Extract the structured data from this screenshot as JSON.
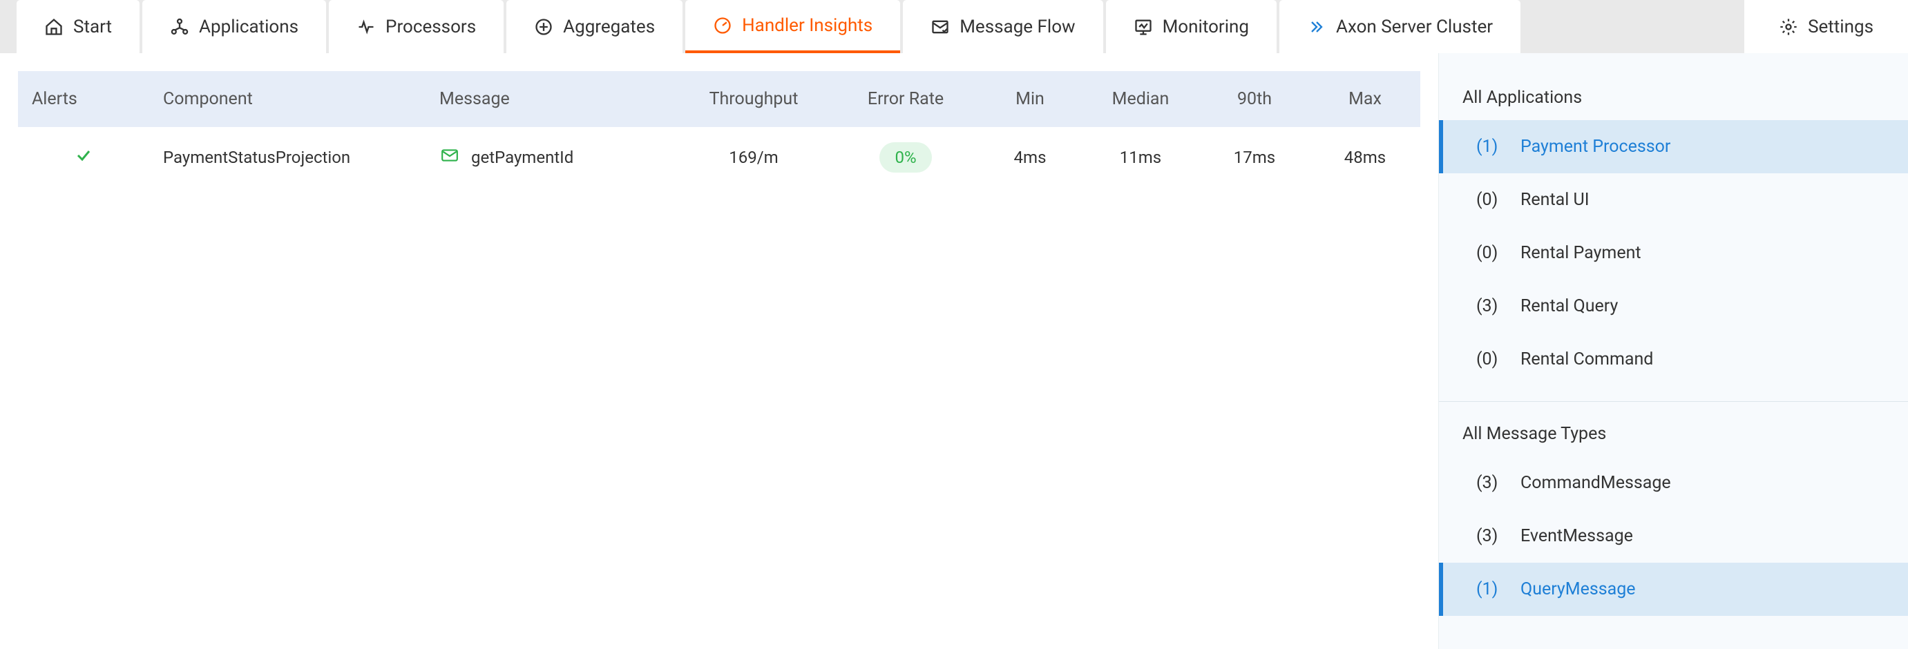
{
  "tabs": {
    "start": "Start",
    "applications": "Applications",
    "processors": "Processors",
    "aggregates": "Aggregates",
    "handler_insights": "Handler Insights",
    "message_flow": "Message Flow",
    "monitoring": "Monitoring",
    "axon_server_cluster": "Axon Server Cluster",
    "settings": "Settings"
  },
  "table": {
    "headers": {
      "alerts": "Alerts",
      "component": "Component",
      "message": "Message",
      "throughput": "Throughput",
      "error_rate": "Error Rate",
      "min": "Min",
      "median": "Median",
      "p90": "90th",
      "max": "Max"
    },
    "rows": [
      {
        "component": "PaymentStatusProjection",
        "message": "getPaymentId",
        "throughput": "169/m",
        "error_rate": "0%",
        "min": "4ms",
        "median": "11ms",
        "p90": "17ms",
        "max": "48ms"
      }
    ]
  },
  "sidebar": {
    "applications_title": "All Applications",
    "applications": [
      {
        "count": "(1)",
        "label": "Payment Processor",
        "active": true
      },
      {
        "count": "(0)",
        "label": "Rental UI",
        "active": false
      },
      {
        "count": "(0)",
        "label": "Rental Payment",
        "active": false
      },
      {
        "count": "(3)",
        "label": "Rental Query",
        "active": false
      },
      {
        "count": "(0)",
        "label": "Rental Command",
        "active": false
      }
    ],
    "message_types_title": "All Message Types",
    "message_types": [
      {
        "count": "(3)",
        "label": "CommandMessage",
        "active": false
      },
      {
        "count": "(3)",
        "label": "EventMessage",
        "active": false
      },
      {
        "count": "(1)",
        "label": "QueryMessage",
        "active": true
      }
    ]
  }
}
